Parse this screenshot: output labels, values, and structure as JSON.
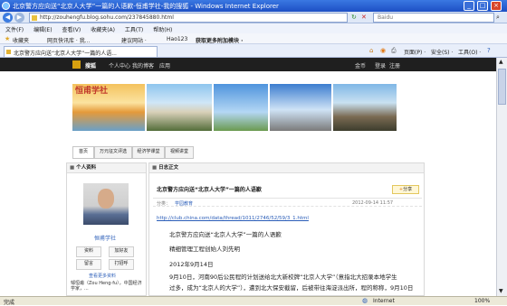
{
  "window": {
    "title": "北京警方应向送“北京人大学”一篇的人语歉-恒甫学社-我的搜狐 - Windows Internet Explorer",
    "controls": {
      "minimize": "_",
      "maximize": "□",
      "close": "×"
    }
  },
  "address_bar": {
    "url": "http://zouhengfu.blog.sohu.com/237845880.html",
    "search_placeholder": "Baidu"
  },
  "menu": [
    "文件(F)",
    "编辑(E)",
    "查看(V)",
    "收藏夹(A)",
    "工具(T)",
    "帮助(H)"
  ],
  "favorites_bar": {
    "label": "收藏夹",
    "items": [
      "网页快讯库 · 我...",
      "建议网站 ·",
      "Hao123",
      "获取更多附加模块 ·"
    ]
  },
  "tab": {
    "label": "北京警方应向送“北京人大学”一篇的人语...",
    "tools": [
      "页面(P) ·",
      "安全(S) ·",
      "工具(O) ·"
    ]
  },
  "site_nav": {
    "logo": "搜狐",
    "items": [
      "个人中心",
      "我的博客",
      "应用"
    ],
    "right_items": [
      "金币",
      "登录",
      "注册"
    ]
  },
  "banner": {
    "blog_name": "恒甫学社"
  },
  "page_tabs": [
    "首页",
    "万元征文评选",
    "经济学课堂",
    "视频讲堂"
  ],
  "sidebar": {
    "title": "个人资料",
    "name": "恒甫学社",
    "buttons": [
      "资料",
      "加好友",
      "留言",
      "打招呼"
    ],
    "links": [
      "查看更多资料"
    ],
    "bio": "邹恒甫（Zou Heng-fu），中国经济学家，..."
  },
  "main": {
    "section": "日志正文",
    "post_title": "北京警方应向送“北京人大学”一篇的人语歉",
    "share_label": "分享",
    "category_label": "分类：",
    "category": "学园教育",
    "date": "2012-09-14 11:57",
    "source_url": "http://club.china.com/data/thread/1011/2746/52/59/3_1.html",
    "body": [
      "北京警方应向送“北京人大学”一篇的人语歉",
      "精细管理工程创始人刘先明",
      "2012年9月14日",
      "9月10日，河南90后公民程的计划送给北大新校牌“北京人大学”（意指北大招录本地学生",
      "过多，成为“北京人的大学”），遭到北大保安截留，后被带往海淀派出所，程的称称，9月10日"
    ]
  },
  "status": {
    "left": "完成",
    "zone": "Internet",
    "zoom": "100%"
  }
}
